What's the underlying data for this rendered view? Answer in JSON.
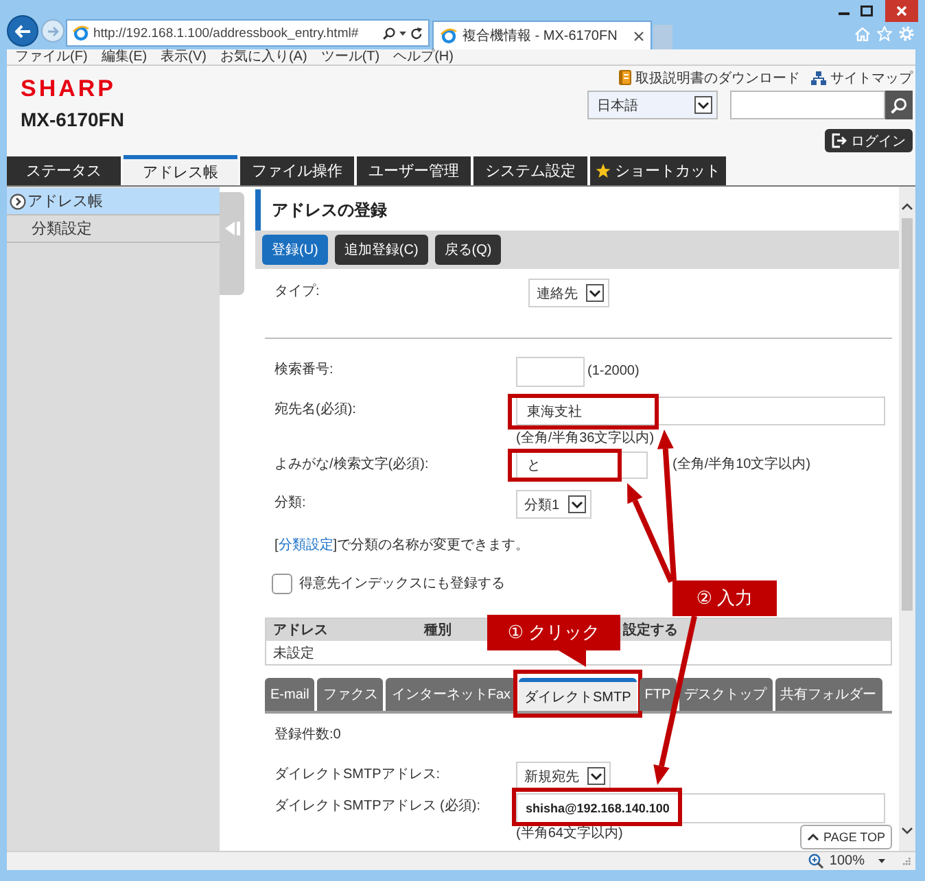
{
  "browser": {
    "url": "http://192.168.1.100/addressbook_entry.html#",
    "tab_title": "複合機情報 - MX-6170FN",
    "menu": [
      "ファイル(F)",
      "編集(E)",
      "表示(V)",
      "お気に入り(A)",
      "ツール(T)",
      "ヘルプ(H)"
    ],
    "zoom": "100%"
  },
  "header": {
    "logo": "SHARP",
    "model": "MX-6170FN",
    "links": [
      {
        "label": "取扱説明書のダウンロード",
        "kind": "manual"
      },
      {
        "label": "サイトマップ",
        "kind": "sitemap"
      }
    ],
    "language": "日本語",
    "login": "ログイン"
  },
  "main_tabs": [
    {
      "label": "ステータス",
      "selected": false,
      "kind": "plain"
    },
    {
      "label": "アドレス帳",
      "selected": true,
      "kind": "plain"
    },
    {
      "label": "ファイル操作",
      "selected": false,
      "kind": "plain"
    },
    {
      "label": "ユーザー管理",
      "selected": false,
      "kind": "plain"
    },
    {
      "label": "システム設定",
      "selected": false,
      "kind": "plain"
    },
    {
      "label": "ショートカット",
      "selected": false,
      "kind": "starred"
    }
  ],
  "sidebar": {
    "items": [
      {
        "label": "アドレス帳",
        "selected": true
      },
      {
        "label": "分類設定",
        "selected": false
      }
    ]
  },
  "panel": {
    "title": "アドレスの登録",
    "buttons": [
      {
        "label": "登録(U)",
        "kind": "primary"
      },
      {
        "label": "追加登録(C)",
        "kind": "default"
      },
      {
        "label": "戻る(Q)",
        "kind": "default"
      }
    ]
  },
  "form": {
    "type": {
      "label": "タイプ:",
      "value": "連絡先"
    },
    "search_number": {
      "label": "検索番号:",
      "range": "(1-2000)"
    },
    "name": {
      "label": "宛先名(必須):",
      "value": "東海支社",
      "hint": "(全角/半角36文字以内)",
      "highlighted": true
    },
    "reading": {
      "label": "よみがな/検索文字(必須):",
      "value": "と",
      "hint": "(全角/半角10文字以内)",
      "highlighted": true
    },
    "category": {
      "label": "分類:",
      "value": "分類1"
    },
    "category_note": {
      "before": "[",
      "link": "分類設定",
      "after": "]で分類の名称が変更できます。"
    },
    "index_option": {
      "label": "得意先インデックスにも登録する",
      "checked": false
    }
  },
  "address_table": {
    "columns": [
      "アドレス",
      "種別",
      "設定する"
    ],
    "empty_message": "未設定"
  },
  "destination_tabs": [
    {
      "label": "E-mail",
      "selected": false,
      "highlighted": false
    },
    {
      "label": "ファクス",
      "selected": false,
      "highlighted": false
    },
    {
      "label": "インターネットFax",
      "selected": false,
      "highlighted": false
    },
    {
      "label": "ダイレクトSMTP",
      "selected": true,
      "highlighted": true
    },
    {
      "label": "FTP",
      "selected": false,
      "highlighted": false
    },
    {
      "label": "デスクトップ",
      "selected": false,
      "highlighted": false
    },
    {
      "label": "共有フォルダー",
      "selected": false,
      "highlighted": false
    }
  ],
  "smtp": {
    "count": "登録件数:0",
    "address": {
      "label": "ダイレクトSMTPアドレス:",
      "value": "新規宛先"
    },
    "required": {
      "label": "ダイレクトSMTPアドレス (必須):",
      "value": "shisha@192.168.140.100",
      "hint": "(半角64文字以内)",
      "highlighted": true
    }
  },
  "page_top": "PAGE TOP",
  "callouts": [
    {
      "text": "① クリック"
    },
    {
      "text": "② 入力"
    }
  ]
}
